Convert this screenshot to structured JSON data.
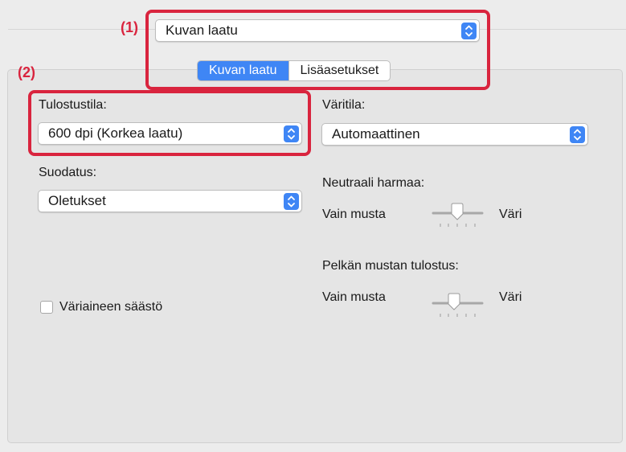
{
  "callouts": {
    "one": "(1)",
    "two": "(2)"
  },
  "preset_popup": {
    "value": "Kuvan laatu"
  },
  "tabs": [
    {
      "label": "Kuvan laatu",
      "selected": true
    },
    {
      "label": "Lisäasetukset",
      "selected": false
    }
  ],
  "print_mode": {
    "label": "Tulostustila:",
    "value": "600 dpi (Korkea laatu)"
  },
  "filter": {
    "label": "Suodatus:",
    "value": "Oletukset"
  },
  "color_mode": {
    "label": "Väritila:",
    "value": "Automaattinen"
  },
  "neutral_gray": {
    "label": "Neutraali harmaa:",
    "left_label": "Vain musta",
    "right_label": "Väri",
    "level": 0.5
  },
  "black_only_print": {
    "label": "Pelkän mustan tulostus:",
    "left_label": "Vain musta",
    "right_label": "Väri",
    "level": 0.5
  },
  "toner_save": {
    "label": "Väriaineen säästö",
    "checked": false
  },
  "colors": {
    "accent": "#3f86f5",
    "callout_red": "#d9243e"
  }
}
